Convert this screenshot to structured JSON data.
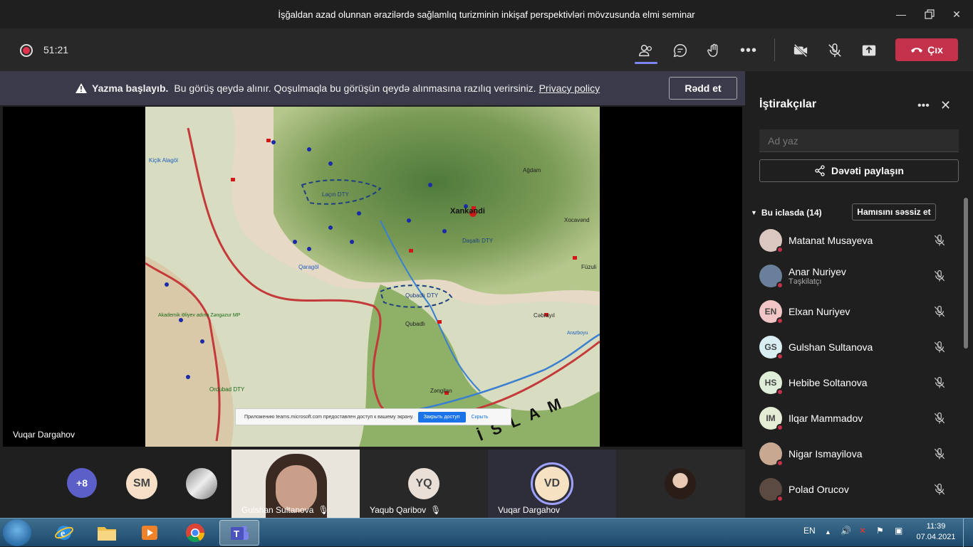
{
  "window": {
    "title": "İşğaldan azad olunnan ərazilərdə sağlamlıq turizminin inkişaf perspektivləri mövzusunda elmi seminar"
  },
  "toolbar": {
    "timer": "51:21",
    "leave_label": "Çıx"
  },
  "banner": {
    "bold": "Yazma başlayıb.",
    "message": "Bu görüş qeydə alınır. Qoşulmaqla bu görüşün qeydə alınmasına razılıq verirsiniz.",
    "link": "Privacy policy",
    "decline_label": "Rədd et"
  },
  "stage": {
    "presenter": "Vuqar Dargahov",
    "share_notice": "Приложению teams.microsoft.com предоставлен доступ к вашему экрану.",
    "share_stop": "Закрыть доступ",
    "share_hide": "Скрыть",
    "map_labels": {
      "xankendi": "Xankəndi",
      "islam": "İSLAM",
      "lacin": "Laçın DTY",
      "qubadli": "Qubadlı DTY",
      "kicik_alagol": "Kiçik Alagöl",
      "cabrayil": "Cəbrayıl",
      "fuzuli": "Füzuli",
      "agdam": "Ağdam",
      "xocavend": "Xocavənd",
      "qaragol": "Qaragöl",
      "qubadli_town": "Qubadlı",
      "zengilan": "Zəngilan",
      "ordubad": "Ordubad DTY",
      "zangezur": "Akademik Əliyev adına Zəngəzur MP",
      "daslin": "Daşaltı DTY",
      "arazboyu": "Arazboyu"
    }
  },
  "gallery": {
    "overflow": "+8",
    "sm_initials": "SM",
    "tiles": [
      {
        "name": "Gulshan Sultanova"
      },
      {
        "name": "Yaqub Qaribov",
        "initials": "YQ"
      },
      {
        "name": "Vuqar Dargahov",
        "initials": "VD"
      }
    ]
  },
  "panel": {
    "title": "İştirakçılar",
    "search_placeholder": "Ad yaz",
    "invite_label": "Dəvəti paylaşın",
    "section_label": "Bu iclasda (14)",
    "mute_all": "Hamısını səssiz et",
    "participants": [
      {
        "name": "Matanat Musayeva",
        "role": "",
        "initials": "",
        "color": "#d9c7c0"
      },
      {
        "name": "Anar Nuriyev",
        "role": "Təşkilatçı",
        "initials": "",
        "color": "#6a7f99"
      },
      {
        "name": "Elxan Nuriyev",
        "role": "",
        "initials": "EN",
        "color": "#f2c6c6"
      },
      {
        "name": "Gulshan Sultanova",
        "role": "",
        "initials": "GS",
        "color": "#d8eef2"
      },
      {
        "name": "Hebibe Soltanova",
        "role": "",
        "initials": "HS",
        "color": "#dfeed8"
      },
      {
        "name": "Ilqar Mammadov",
        "role": "",
        "initials": "IM",
        "color": "#e5ecd5"
      },
      {
        "name": "Nigar Ismayilova",
        "role": "",
        "initials": "",
        "color": "#c9a892"
      },
      {
        "name": "Polad Orucov",
        "role": "",
        "initials": "",
        "color": "#5a4a40"
      }
    ]
  },
  "taskbar": {
    "language": "EN",
    "time": "11:39",
    "date": "07.04.2021"
  }
}
